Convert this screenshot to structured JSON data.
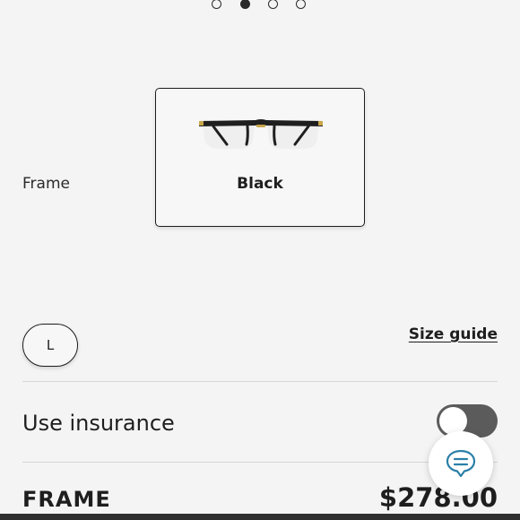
{
  "carousel": {
    "dot_count": 4,
    "active_index": 1
  },
  "frame": {
    "label": "Frame",
    "options": [
      {
        "color_name": "Black",
        "selected": true
      }
    ]
  },
  "size": {
    "selected": "L",
    "guide_link": "Size guide"
  },
  "insurance": {
    "label": "Use insurance",
    "enabled": false
  },
  "summary": {
    "label": "FRAME",
    "price": "$278.00"
  },
  "icons": {
    "chat": "chat-bubble-icon"
  },
  "colors": {
    "text": "#1e1e1e",
    "toggle_off": "#5b5b5b",
    "background": "#f4f4f4"
  }
}
